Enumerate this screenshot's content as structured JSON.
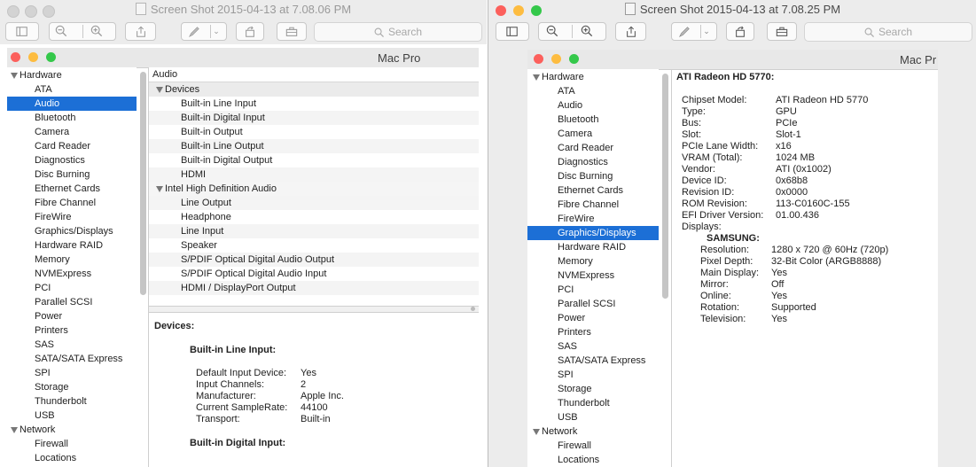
{
  "window1": {
    "title": "Screen Shot 2015-04-13 at 7.08.06 PM",
    "search_placeholder": "Search",
    "sysinfo": {
      "machine": "Mac Pro",
      "sidebar": {
        "hardware_header": "Hardware",
        "hardware_items": [
          "ATA",
          "Audio",
          "Bluetooth",
          "Camera",
          "Card Reader",
          "Diagnostics",
          "Disc Burning",
          "Ethernet Cards",
          "Fibre Channel",
          "FireWire",
          "Graphics/Displays",
          "Hardware RAID",
          "Memory",
          "NVMExpress",
          "PCI",
          "Parallel SCSI",
          "Power",
          "Printers",
          "SAS",
          "SATA/SATA Express",
          "SPI",
          "Storage",
          "Thunderbolt",
          "USB"
        ],
        "selected": "Audio",
        "network_header": "Network",
        "network_items": [
          "Firewall",
          "Locations"
        ]
      },
      "list": {
        "column_header": "Audio",
        "groups": [
          {
            "name": "Devices",
            "items": [
              "Built-in Line Input",
              "Built-in Digital Input",
              "Built-in Output",
              "Built-in Line Output",
              "Built-in Digital Output",
              "HDMI"
            ]
          },
          {
            "name": "Intel High Definition Audio",
            "items": [
              "Line Output",
              "Headphone",
              "Line Input",
              "Speaker",
              "S/PDIF Optical Digital Audio Output",
              "S/PDIF Optical Digital Audio Input",
              "HDMI / DisplayPort Output"
            ]
          }
        ]
      },
      "detail": {
        "heading": "Devices:",
        "sections": [
          {
            "title": "Built-in Line Input:",
            "rows": [
              {
                "k": "Default Input Device:",
                "v": "Yes"
              },
              {
                "k": "Input Channels:",
                "v": "2"
              },
              {
                "k": "Manufacturer:",
                "v": "Apple Inc."
              },
              {
                "k": "Current SampleRate:",
                "v": "44100"
              },
              {
                "k": "Transport:",
                "v": "Built-in"
              }
            ]
          },
          {
            "title": "Built-in Digital Input:",
            "rows": []
          }
        ]
      }
    }
  },
  "window2": {
    "title": "Screen Shot 2015-04-13 at 7.08.25 PM",
    "search_placeholder": "Search",
    "sysinfo": {
      "machine": "Mac Pr",
      "sidebar": {
        "hardware_header": "Hardware",
        "hardware_items": [
          "ATA",
          "Audio",
          "Bluetooth",
          "Camera",
          "Card Reader",
          "Diagnostics",
          "Disc Burning",
          "Ethernet Cards",
          "Fibre Channel",
          "FireWire",
          "Graphics/Displays",
          "Hardware RAID",
          "Memory",
          "NVMExpress",
          "PCI",
          "Parallel SCSI",
          "Power",
          "Printers",
          "SAS",
          "SATA/SATA Express",
          "SPI",
          "Storage",
          "Thunderbolt",
          "USB"
        ],
        "selected": "Graphics/Displays",
        "network_header": "Network",
        "network_items": [
          "Firewall",
          "Locations"
        ]
      },
      "detail": {
        "heading": "ATI Radeon HD 5770:",
        "rows": [
          {
            "k": "Chipset Model:",
            "v": "ATI Radeon HD 5770"
          },
          {
            "k": "Type:",
            "v": "GPU"
          },
          {
            "k": "Bus:",
            "v": "PCIe"
          },
          {
            "k": "Slot:",
            "v": "Slot-1"
          },
          {
            "k": "PCIe Lane Width:",
            "v": "x16"
          },
          {
            "k": "VRAM (Total):",
            "v": "1024 MB"
          },
          {
            "k": "Vendor:",
            "v": "ATI (0x1002)"
          },
          {
            "k": "Device ID:",
            "v": "0x68b8"
          },
          {
            "k": "Revision ID:",
            "v": "0x0000"
          },
          {
            "k": "ROM Revision:",
            "v": "113-C0160C-155"
          },
          {
            "k": "EFI Driver Version:",
            "v": "01.00.436"
          }
        ],
        "displays_label": "Displays:",
        "display_name": "SAMSUNG:",
        "display_rows": [
          {
            "k": "Resolution:",
            "v": "1280 x 720 @ 60Hz (720p)"
          },
          {
            "k": "Pixel Depth:",
            "v": "32-Bit Color (ARGB8888)"
          },
          {
            "k": "Main Display:",
            "v": "Yes"
          },
          {
            "k": "Mirror:",
            "v": "Off"
          },
          {
            "k": "Online:",
            "v": "Yes"
          },
          {
            "k": "Rotation:",
            "v": "Supported"
          },
          {
            "k": "Television:",
            "v": "Yes"
          }
        ]
      }
    }
  },
  "colors": {
    "selection": "#1c6fd6",
    "close": "#fc605c",
    "minimize": "#fdbc40",
    "zoom": "#34c84a",
    "inactive_light": "#d0d0d0"
  }
}
